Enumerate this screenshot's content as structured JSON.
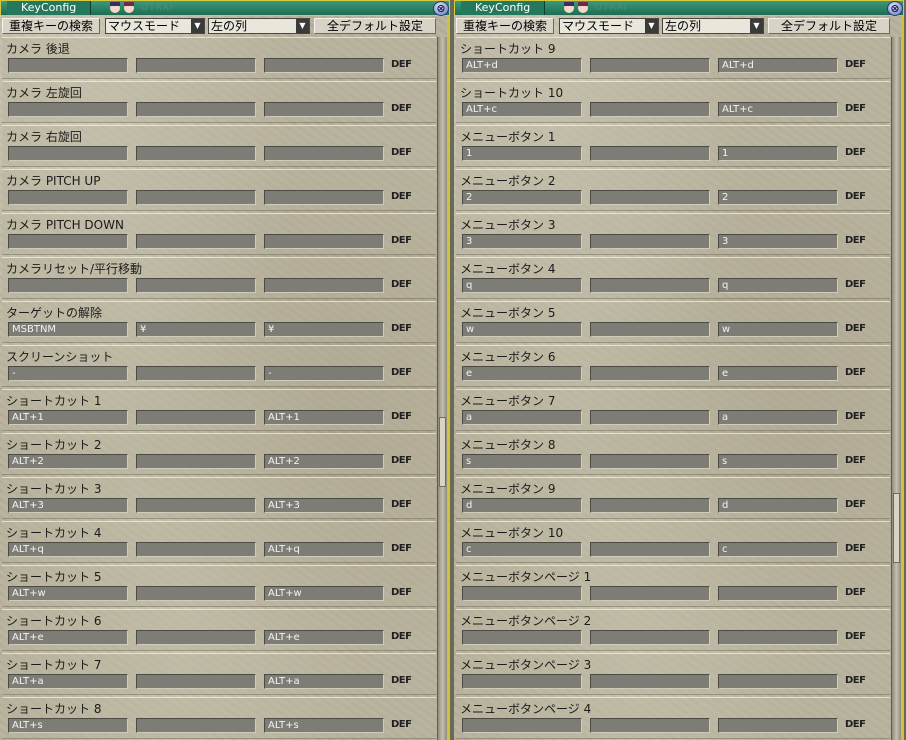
{
  "windows": [
    {
      "title": "KeyConfig",
      "watermark": "OTRAI",
      "close_glyph": "⊗",
      "toolbar": {
        "search_dup_label": "重複キーの検索",
        "mode_value": "マウスモード",
        "column_value": "左の列",
        "all_default_label": "全デフォルト設定",
        "arrow_glyph": "▼"
      },
      "scroll_thumb_position": 0.6,
      "rows": [
        {
          "label": "カメラ 後退",
          "k1": "",
          "k2": "",
          "k3": "",
          "def": "DEF"
        },
        {
          "label": "カメラ 左旋回",
          "k1": "",
          "k2": "",
          "k3": "",
          "def": "DEF"
        },
        {
          "label": "カメラ 右旋回",
          "k1": "",
          "k2": "",
          "k3": "",
          "def": "DEF"
        },
        {
          "label": "カメラ PITCH UP",
          "k1": "",
          "k2": "",
          "k3": "",
          "def": "DEF"
        },
        {
          "label": "カメラ PITCH DOWN",
          "k1": "",
          "k2": "",
          "k3": "",
          "def": "DEF"
        },
        {
          "label": "カメラリセット/平行移動",
          "k1": "",
          "k2": "",
          "k3": "",
          "def": "DEF"
        },
        {
          "label": "ターゲットの解除",
          "k1": "MSBTNM",
          "k2": "¥",
          "k3": "¥",
          "def": "DEF"
        },
        {
          "label": "スクリーンショット",
          "k1": "-",
          "k2": "",
          "k3": "-",
          "def": "DEF"
        },
        {
          "label": "ショートカット 1",
          "k1": "ALT+1",
          "k2": "",
          "k3": "ALT+1",
          "def": "DEF"
        },
        {
          "label": "ショートカット 2",
          "k1": "ALT+2",
          "k2": "",
          "k3": "ALT+2",
          "def": "DEF"
        },
        {
          "label": "ショートカット 3",
          "k1": "ALT+3",
          "k2": "",
          "k3": "ALT+3",
          "def": "DEF"
        },
        {
          "label": "ショートカット 4",
          "k1": "ALT+q",
          "k2": "",
          "k3": "ALT+q",
          "def": "DEF"
        },
        {
          "label": "ショートカット 5",
          "k1": "ALT+w",
          "k2": "",
          "k3": "ALT+w",
          "def": "DEF"
        },
        {
          "label": "ショートカット 6",
          "k1": "ALT+e",
          "k2": "",
          "k3": "ALT+e",
          "def": "DEF"
        },
        {
          "label": "ショートカット 7",
          "k1": "ALT+a",
          "k2": "",
          "k3": "ALT+a",
          "def": "DEF"
        },
        {
          "label": "ショートカット 8",
          "k1": "ALT+s",
          "k2": "",
          "k3": "ALT+s",
          "def": "DEF"
        }
      ]
    },
    {
      "title": "KeyConfig",
      "watermark": "OTRAI",
      "close_glyph": "⊗",
      "toolbar": {
        "search_dup_label": "重複キーの検索",
        "mode_value": "マウスモード",
        "column_value": "左の列",
        "all_default_label": "全デフォルト設定",
        "arrow_glyph": "▼"
      },
      "scroll_thumb_position": 0.72,
      "rows": [
        {
          "label": "ショートカット 9",
          "k1": "ALT+d",
          "k2": "",
          "k3": "ALT+d",
          "def": "DEF"
        },
        {
          "label": "ショートカット 10",
          "k1": "ALT+c",
          "k2": "",
          "k3": "ALT+c",
          "def": "DEF"
        },
        {
          "label": "メニューボタン 1",
          "k1": "1",
          "k2": "",
          "k3": "1",
          "def": "DEF"
        },
        {
          "label": "メニューボタン 2",
          "k1": "2",
          "k2": "",
          "k3": "2",
          "def": "DEF"
        },
        {
          "label": "メニューボタン 3",
          "k1": "3",
          "k2": "",
          "k3": "3",
          "def": "DEF"
        },
        {
          "label": "メニューボタン 4",
          "k1": "q",
          "k2": "",
          "k3": "q",
          "def": "DEF"
        },
        {
          "label": "メニューボタン 5",
          "k1": "w",
          "k2": "",
          "k3": "w",
          "def": "DEF"
        },
        {
          "label": "メニューボタン 6",
          "k1": "e",
          "k2": "",
          "k3": "e",
          "def": "DEF"
        },
        {
          "label": "メニューボタン 7",
          "k1": "a",
          "k2": "",
          "k3": "a",
          "def": "DEF"
        },
        {
          "label": "メニューボタン 8",
          "k1": "s",
          "k2": "",
          "k3": "s",
          "def": "DEF"
        },
        {
          "label": "メニューボタン 9",
          "k1": "d",
          "k2": "",
          "k3": "d",
          "def": "DEF"
        },
        {
          "label": "メニューボタン 10",
          "k1": "c",
          "k2": "",
          "k3": "c",
          "def": "DEF"
        },
        {
          "label": "メニューボタンページ 1",
          "k1": "",
          "k2": "",
          "k3": "",
          "def": "DEF"
        },
        {
          "label": "メニューボタンページ 2",
          "k1": "",
          "k2": "",
          "k3": "",
          "def": "DEF"
        },
        {
          "label": "メニューボタンページ 3",
          "k1": "",
          "k2": "",
          "k3": "",
          "def": "DEF"
        },
        {
          "label": "メニューボタンページ 4",
          "k1": "",
          "k2": "",
          "k3": "",
          "def": "DEF"
        }
      ]
    }
  ],
  "colors": {
    "title_bar": "#2a8565",
    "window_border": "#d6c840",
    "field_bg": "#7d7d76",
    "field_text": "#f4f4f4"
  }
}
